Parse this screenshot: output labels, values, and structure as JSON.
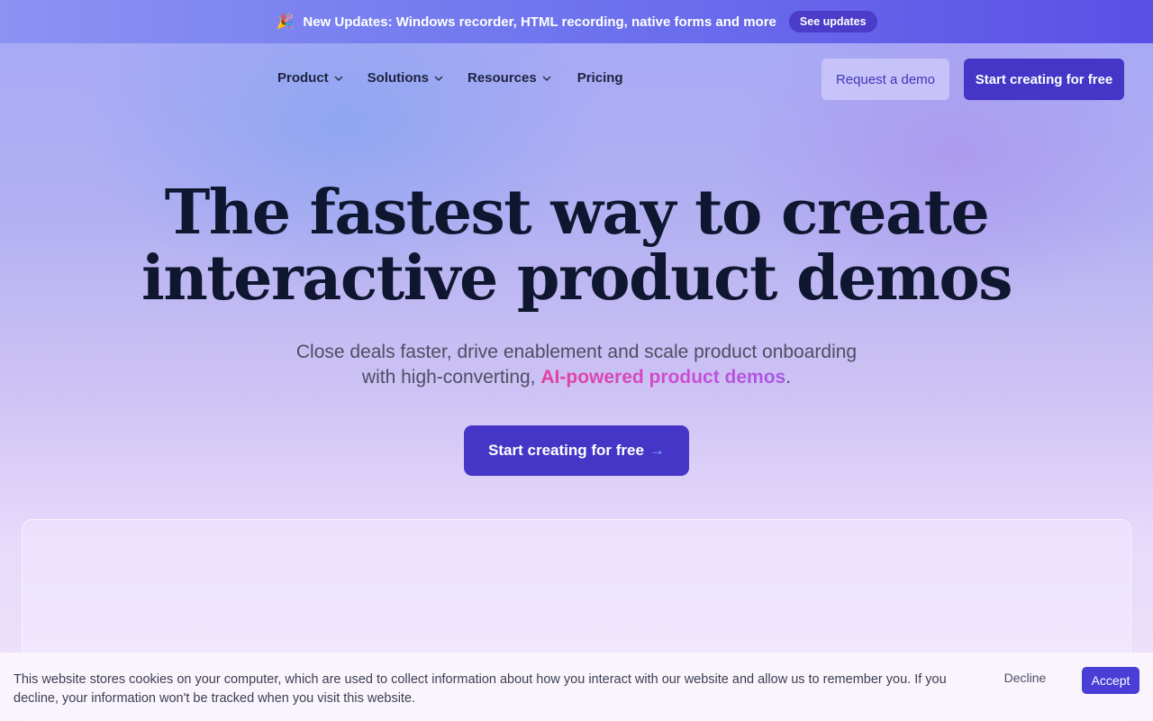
{
  "announcement": {
    "emoji": "🎉",
    "text": "New Updates: Windows recorder, HTML recording, native forms and more",
    "button_label": "See updates"
  },
  "nav": {
    "items": [
      {
        "label": "Product",
        "has_dropdown": true
      },
      {
        "label": "Solutions",
        "has_dropdown": true
      },
      {
        "label": "Resources",
        "has_dropdown": true
      },
      {
        "label": "Pricing",
        "has_dropdown": false
      }
    ],
    "request_demo_label": "Request a demo",
    "start_free_label": "Start creating for free"
  },
  "hero": {
    "title_line1": "The fastest way to create",
    "title_line2": "interactive product demos",
    "subtitle_line1": "Close deals faster, drive enablement and scale product onboarding",
    "subtitle_line2_prefix": "with high-converting,",
    "subtitle_highlight": "AI-powered product demos",
    "subtitle_suffix": ".",
    "cta_label": "Start creating for free",
    "cta_arrow": "→"
  },
  "cookie_banner": {
    "text": "This website stores cookies on your computer, which are used to collect information about how you interact with our website and allow us to remember you. If you decline, your information won't be tracked when you visit this website.",
    "decline_label": "Decline",
    "accept_label": "Accept"
  },
  "colors": {
    "primary": "#4536c8",
    "highlight_start": "#e5409a",
    "highlight_end": "#a659e6"
  }
}
